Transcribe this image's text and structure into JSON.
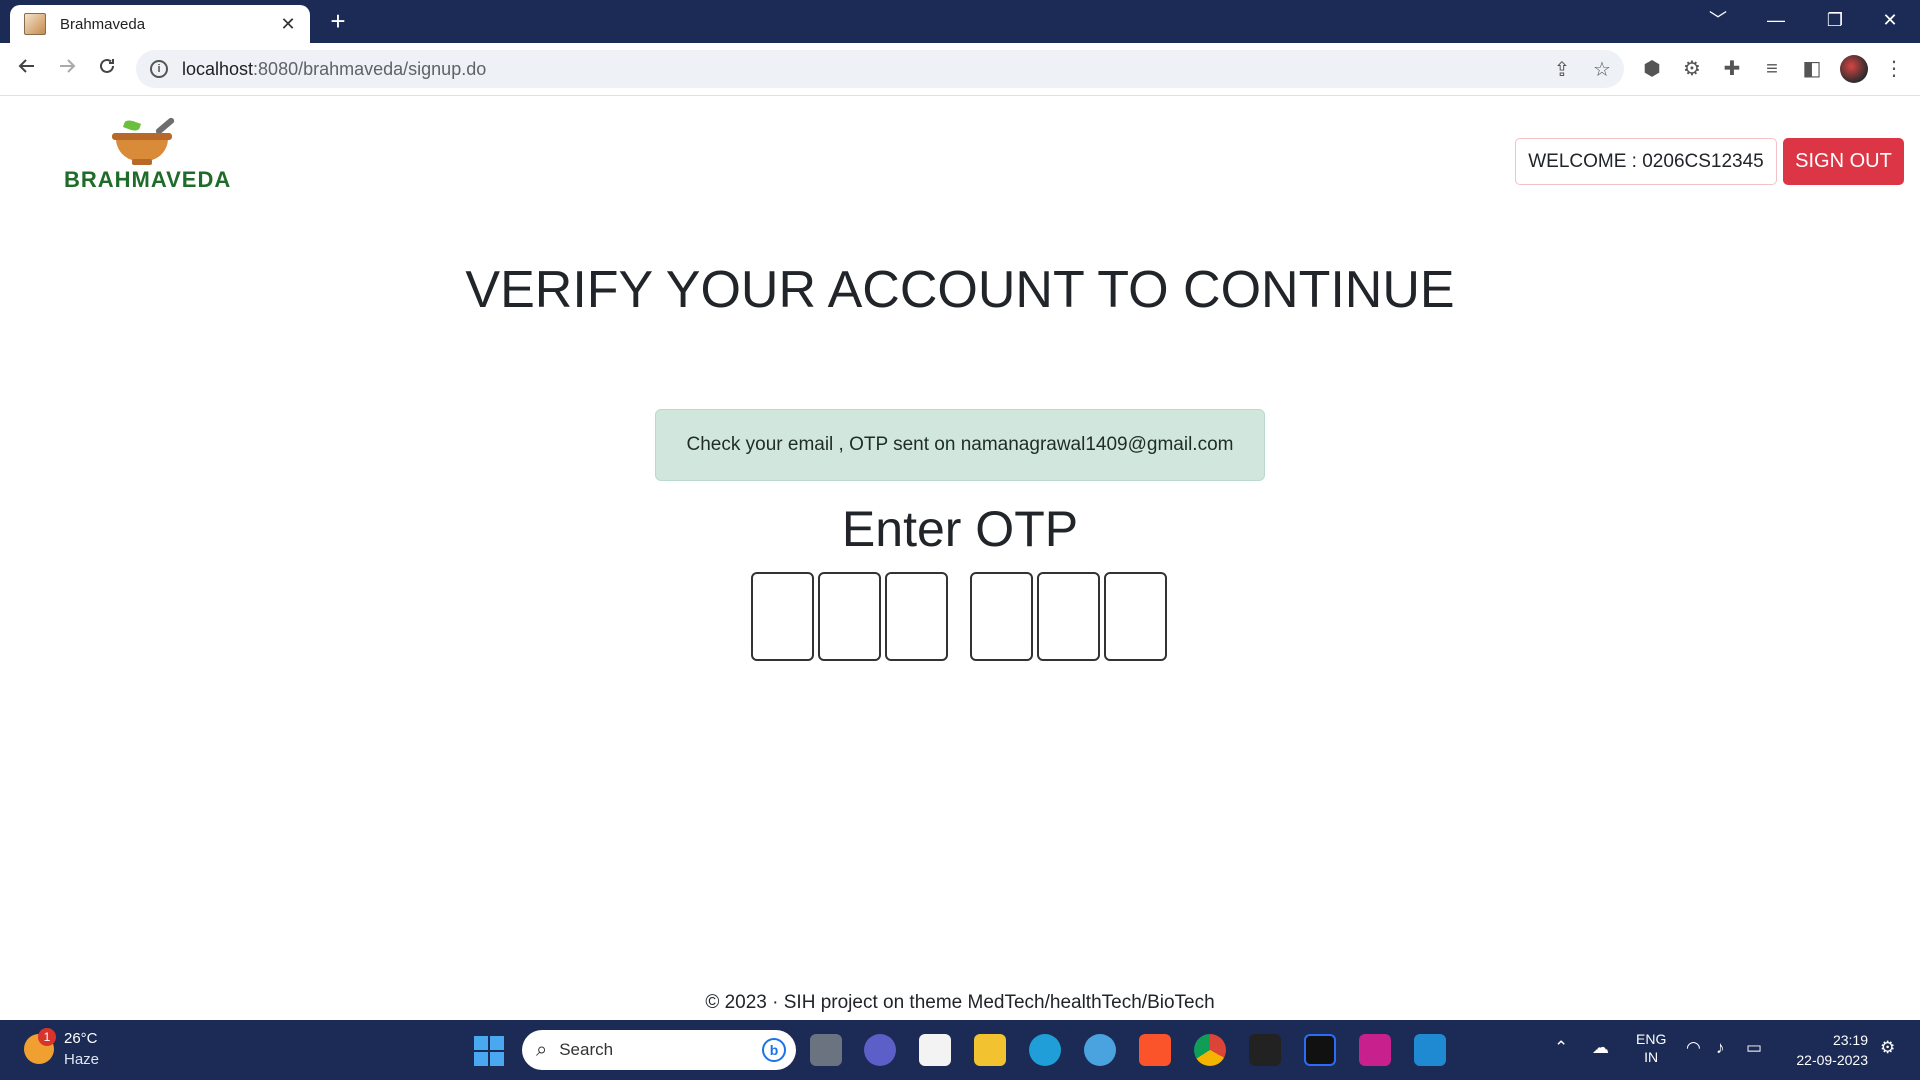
{
  "browser": {
    "tab_title": "Brahmaveda",
    "tab_close": "✕",
    "new_tab": "+",
    "url_host": "localhost",
    "url_rest": ":8080/brahmaveda/signup.do",
    "window_controls": [
      "﹀",
      "—",
      "❐",
      "✕"
    ],
    "nav_icons": [
      "back-icon",
      "forward-icon",
      "reload-icon"
    ],
    "extension_icons": [
      "shield-extension-icon",
      "settings-extension-icon",
      "puzzle-extension-icon",
      "reading-list-icon",
      "side-panel-icon"
    ]
  },
  "header": {
    "logo_text": "BRAHMAVEDA",
    "welcome_text": "WELCOME : 0206CS12345",
    "signout_label": "SIGN OUT"
  },
  "main": {
    "headline": "VERIFY YOUR ACCOUNT TO CONTINUE",
    "alert_message": "Check your email , OTP sent on namanagrawal1409@gmail.com",
    "otp_title": "Enter OTP",
    "otp_values": [
      "",
      "",
      "",
      "",
      "",
      ""
    ]
  },
  "footer": {
    "text": "© 2023 · SIH project on theme MedTech/healthTech/BioTech"
  },
  "taskbar": {
    "weather_badge": "1",
    "weather_temp": "26°C",
    "weather_desc": "Haze",
    "search_placeholder": "Search",
    "apps": [
      "task-view-icon",
      "teams-chat-icon",
      "microsoft-store-icon",
      "file-explorer-icon",
      "edge-icon",
      "maps-icon",
      "brave-icon",
      "chrome-icon",
      "mysql-workbench-icon",
      "webstorm-icon",
      "paint-app-icon",
      "vscode-icon"
    ],
    "lang_line1": "ENG",
    "lang_line2": "IN",
    "time": "23:19",
    "date": "22-09-2023"
  },
  "colors": {
    "chrome_dark": "#1c2b55",
    "signout_red": "#dc3545",
    "alert_green": "#d1e7dd",
    "logo_green": "#1e6b2a"
  }
}
